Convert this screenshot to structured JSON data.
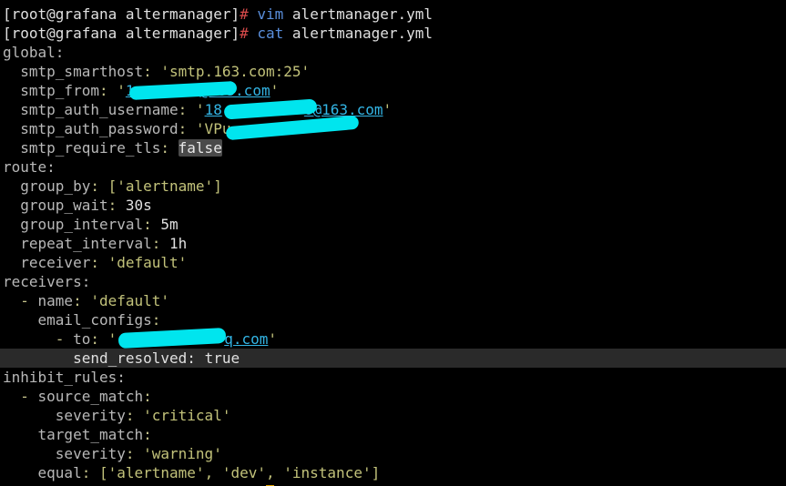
{
  "colors": {
    "background": "#000000",
    "text": "#e0e0e0",
    "key": "#b8b8b8",
    "string": "#c2c27a",
    "link": "#33b5e5",
    "prompt_hash": "#d64a4a",
    "command": "#5a8fdc",
    "redaction": "#00e5ee",
    "cursor": "#e0a000"
  },
  "prompt": {
    "text": "[root@grafana altermanager]",
    "symbol": "#"
  },
  "commands": [
    {
      "cmd": "vim",
      "arg": "alertmanager.yml"
    },
    {
      "cmd": "cat",
      "arg": "alertmanager.yml"
    }
  ],
  "yaml": {
    "global": {
      "key": "global:",
      "smarthost_key": "smtp_smarthost",
      "smarthost_val": "'smtp.163.com:25'",
      "from_key": "smtp_from",
      "from_q": "'",
      "from_val": "1",
      "from_val2": "@163.com",
      "from_q2": "'",
      "user_key": "smtp_auth_username",
      "user_q": "'",
      "user_val": "18",
      "user_val2": "6@163.com",
      "user_q2": "'",
      "pass_key": "smtp_auth_password",
      "pass_val": "'VPu",
      "pass_val2": "'",
      "tls_key": "smtp_require_tls",
      "tls_val": "false"
    },
    "route": {
      "key": "route:",
      "group_by_key": "group_by",
      "group_by_val": "['alertname']",
      "group_wait_key": "group_wait",
      "group_wait_val": "30s",
      "group_interval_key": "group_interval",
      "group_interval_val": "5m",
      "repeat_interval_key": "repeat_interval",
      "repeat_interval_val": "1h",
      "receiver_key": "receiver",
      "receiver_val": "'default'"
    },
    "receivers": {
      "key": "receivers:",
      "name_key": "name",
      "name_val": "'default'",
      "email_key": "email_configs",
      "to_key": "to",
      "to_q": "'",
      "to_val": "q.com",
      "to_q2": "'",
      "send_key": "send_resolved",
      "send_val": "true"
    },
    "inhibit": {
      "key": "inhibit_rules:",
      "source_key": "source_match",
      "sev1_key": "severity",
      "sev1_val": "'critical'",
      "target_key": "target_match",
      "sev2_key": "severity",
      "sev2_val": "'warning'",
      "equal_key": "equal",
      "equal_val": "['alertname', 'dev', 'instance']"
    }
  }
}
